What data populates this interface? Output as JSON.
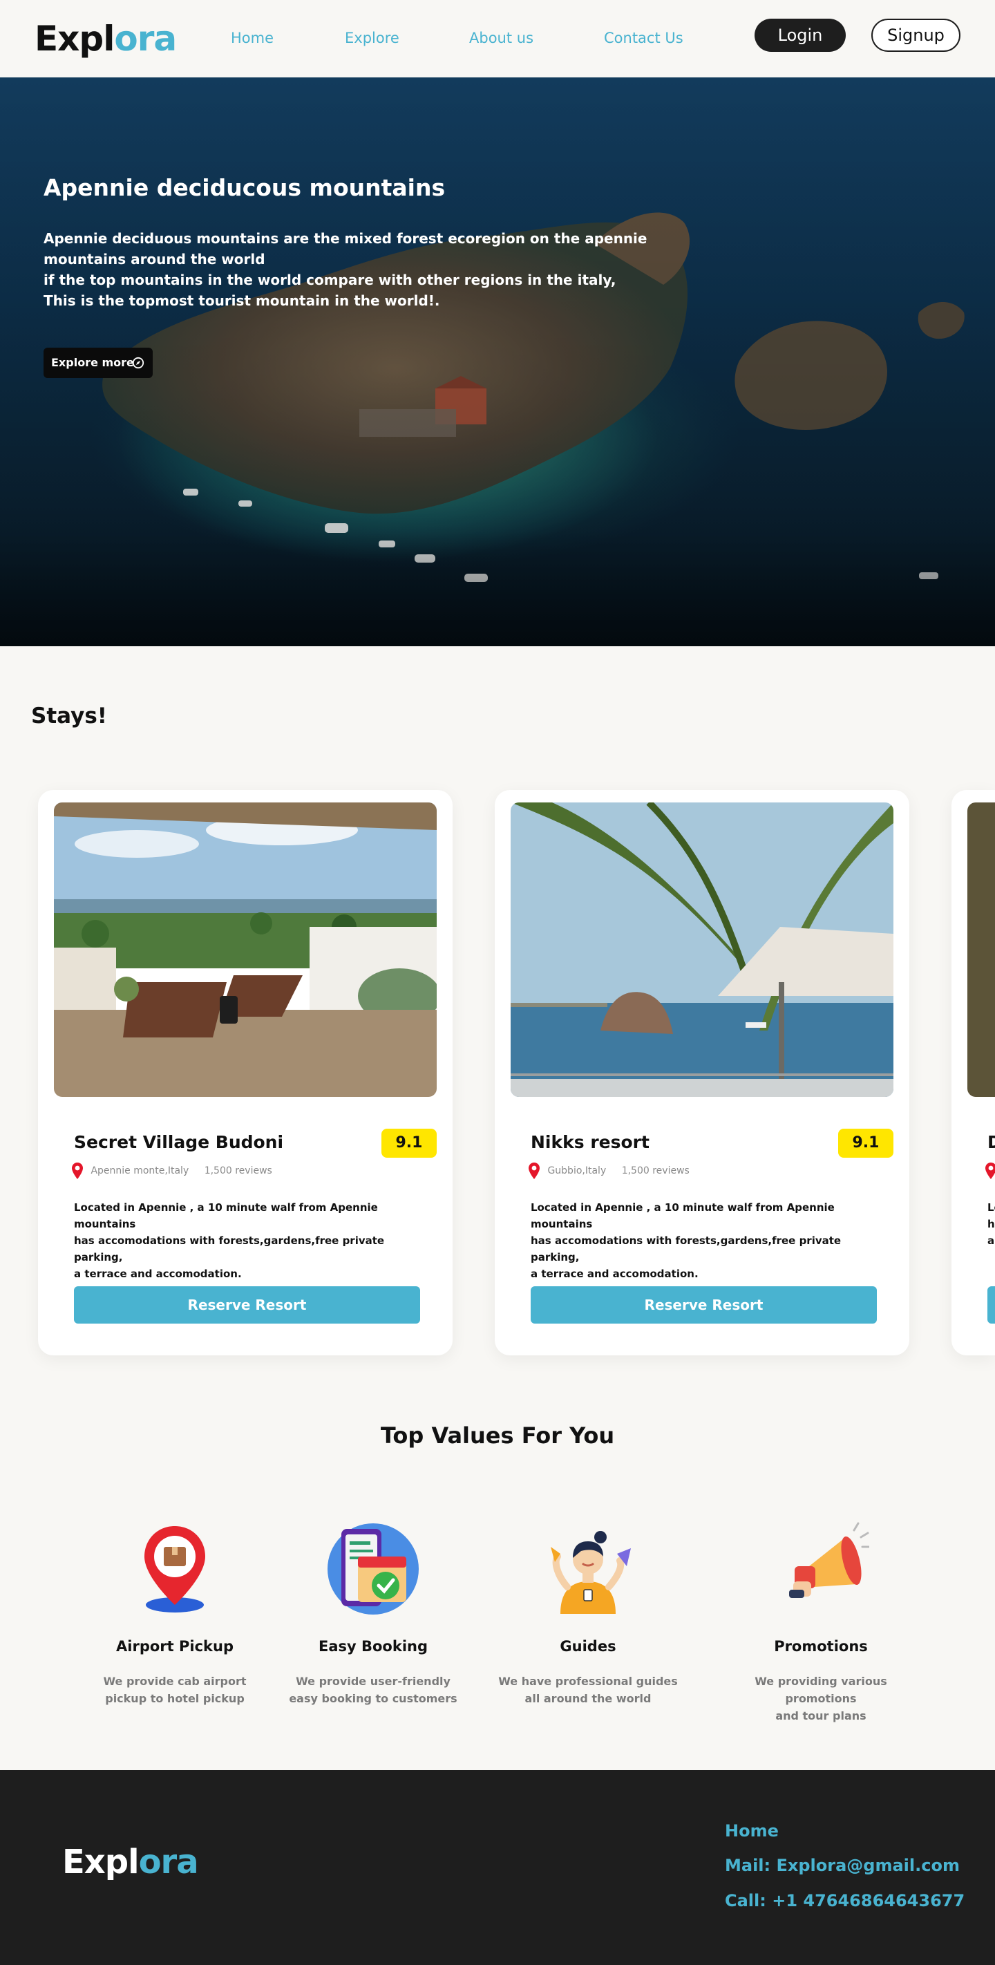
{
  "brand": {
    "part1": "Expl",
    "part2": "ora"
  },
  "nav": {
    "links": [
      "Home",
      "Explore",
      "About us",
      "Contact Us"
    ],
    "login": "Login",
    "signup": "Signup"
  },
  "hero": {
    "title": "Apennie deciducous mountains",
    "lines": [
      "Apennie deciduous mountains are the mixed forest ecoregion on the apennie",
      "mountains around the world",
      "if the top mountains in the world compare with other regions in the italy,",
      "This is the topmost tourist mountain in the world!."
    ],
    "button": "Explore more"
  },
  "stays": {
    "title": "Stays!",
    "cards": [
      {
        "name": "Secret Village Budoni",
        "rating": "9.1",
        "location": "Apennie monte,Italy",
        "reviews": "1,500 reviews",
        "desc_lines": [
          "Located in Apennie ,  a 10 minute walf from Apennie mountains",
          "has accomodations with forests,gardens,free private parking,",
          "a terrace and accomodation."
        ],
        "button": "Reserve Resort"
      },
      {
        "name": "Nikks resort",
        "rating": "9.1",
        "location": "Gubbio,Italy",
        "reviews": "1,500 reviews",
        "desc_lines": [
          "Located in Apennie ,  a 10 minute walf from Apennie mountains",
          "has accomodations with forests,gardens,free private parking,",
          "a terrace and accomodation."
        ],
        "button": "Reserve Resort"
      },
      {
        "name": "D",
        "desc_lines": [
          "Lo",
          "ha",
          "a"
        ]
      }
    ]
  },
  "values": {
    "title": "Top Values For You",
    "items": [
      {
        "icon": "map-pin-package-icon",
        "name": "Airport Pickup",
        "desc": [
          "We provide cab airport",
          "pickup to hotel pickup"
        ]
      },
      {
        "icon": "booking-calendar-icon",
        "name": "Easy Booking",
        "desc": [
          "We provide user-friendly",
          "easy booking to customers"
        ]
      },
      {
        "icon": "guide-person-icon",
        "name": "Guides",
        "desc": [
          "We have professional guides",
          "all around the world"
        ]
      },
      {
        "icon": "megaphone-icon",
        "name": "Promotions",
        "desc": [
          "We providing various promotions",
          "and tour plans"
        ]
      }
    ]
  },
  "footer": {
    "home": "Home",
    "mail": "Mail: Explora@gmail.com",
    "call": "Call: +1 47646864643677"
  },
  "colors": {
    "accent": "#49b3d0",
    "dark": "#1e1e1e",
    "rating": "#ffe600",
    "background": "#f8f7f4"
  }
}
